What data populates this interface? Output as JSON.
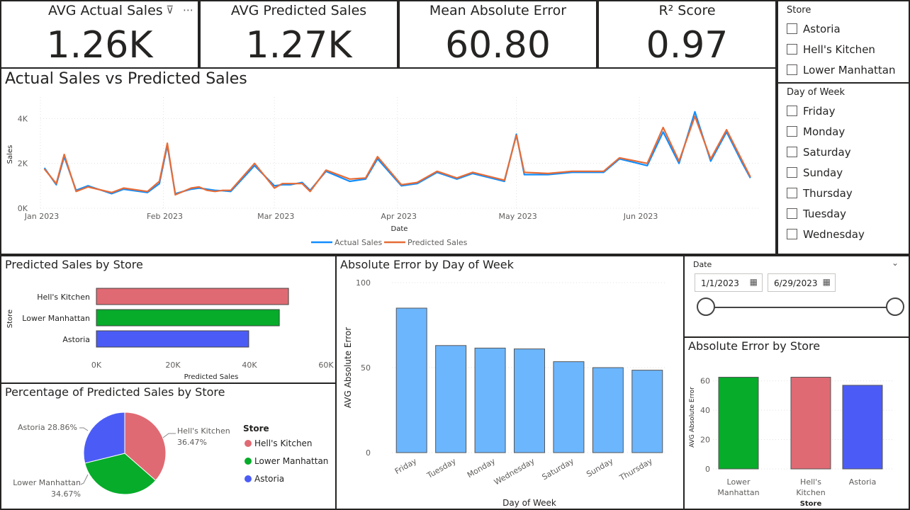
{
  "kpis": [
    {
      "title": "AVG Actual Sales",
      "value": "1.26K"
    },
    {
      "title": "AVG Predicted Sales",
      "value": "1.27K"
    },
    {
      "title": "Mean Absolute Error",
      "value": "60.80"
    },
    {
      "title": "R² Score",
      "value": "0.97"
    }
  ],
  "card_icons": {
    "filter": "filter-icon",
    "more": "more-options-icon"
  },
  "slicer_store": {
    "title": "Store",
    "items": [
      "Astoria",
      "Hell's Kitchen",
      "Lower Manhattan"
    ]
  },
  "slicer_day": {
    "title": "Day of Week",
    "items": [
      "Friday",
      "Monday",
      "Saturday",
      "Sunday",
      "Thursday",
      "Tuesday",
      "Wednesday"
    ]
  },
  "date_slicer": {
    "title": "Date",
    "start": "1/1/2023",
    "end": "6/29/2023",
    "range_fraction": [
      0,
      1
    ]
  },
  "colors": {
    "actual": "#118DFF",
    "predicted": "#E66C37",
    "hells_kitchen": "#E06A73",
    "lower_manhattan": "#06AC2A",
    "astoria": "#4B5CF6",
    "dow_bar": "#6CB6FE"
  },
  "chart_data": [
    {
      "type": "line",
      "title": "Actual Sales vs Predicted Sales",
      "xlabel": "Date",
      "ylabel": "Sales",
      "x_ticks": [
        "Jan 2023",
        "Feb 2023",
        "Mar 2023",
        "Apr 2023",
        "May 2023",
        "Jun 2023"
      ],
      "y_ticks": [
        "0K",
        "2K",
        "4K"
      ],
      "ylim": [
        0,
        4800
      ],
      "xlim": [
        "2023-01-01",
        "2023-07-01"
      ],
      "legend": "bottom",
      "series": [
        {
          "name": "Actual Sales",
          "x": [
            "2023-01-02",
            "2023-01-05",
            "2023-01-07",
            "2023-01-10",
            "2023-01-13",
            "2023-01-19",
            "2023-01-22",
            "2023-01-28",
            "2023-01-31",
            "2023-02-02",
            "2023-02-04",
            "2023-02-08",
            "2023-02-10",
            "2023-02-12",
            "2023-02-14",
            "2023-02-16",
            "2023-02-18",
            "2023-02-24",
            "2023-03-01",
            "2023-03-03",
            "2023-03-05",
            "2023-03-08",
            "2023-03-10",
            "2023-03-14",
            "2023-03-20",
            "2023-03-24",
            "2023-03-27",
            "2023-04-02",
            "2023-04-06",
            "2023-04-11",
            "2023-04-16",
            "2023-04-20",
            "2023-04-28",
            "2023-05-01",
            "2023-05-03",
            "2023-05-09",
            "2023-05-15",
            "2023-05-23",
            "2023-05-27",
            "2023-06-03",
            "2023-06-07",
            "2023-06-11",
            "2023-06-15",
            "2023-06-19",
            "2023-06-23",
            "2023-06-27",
            "2023-06-29"
          ],
          "y": [
            1800,
            1050,
            2300,
            800,
            1000,
            650,
            850,
            700,
            1100,
            2800,
            650,
            850,
            900,
            850,
            800,
            780,
            750,
            1900,
            1000,
            1050,
            1050,
            1150,
            800,
            1650,
            1200,
            1300,
            2200,
            1000,
            1100,
            1600,
            1300,
            1550,
            1200,
            3300,
            1500,
            1500,
            1600,
            1600,
            2200,
            1900,
            3400,
            2000,
            4300,
            2100,
            3400,
            2000,
            1350
          ]
        },
        {
          "name": "Predicted Sales",
          "x": [
            "2023-01-02",
            "2023-01-05",
            "2023-01-07",
            "2023-01-10",
            "2023-01-13",
            "2023-01-19",
            "2023-01-22",
            "2023-01-28",
            "2023-01-31",
            "2023-02-02",
            "2023-02-04",
            "2023-02-08",
            "2023-02-10",
            "2023-02-12",
            "2023-02-14",
            "2023-02-16",
            "2023-02-18",
            "2023-02-24",
            "2023-03-01",
            "2023-03-03",
            "2023-03-05",
            "2023-03-08",
            "2023-03-10",
            "2023-03-14",
            "2023-03-20",
            "2023-03-24",
            "2023-03-27",
            "2023-04-02",
            "2023-04-06",
            "2023-04-11",
            "2023-04-16",
            "2023-04-20",
            "2023-04-28",
            "2023-05-01",
            "2023-05-03",
            "2023-05-09",
            "2023-05-15",
            "2023-05-23",
            "2023-05-27",
            "2023-06-03",
            "2023-06-07",
            "2023-06-11",
            "2023-06-15",
            "2023-06-19",
            "2023-06-23",
            "2023-06-27",
            "2023-06-29"
          ],
          "y": [
            1750,
            1100,
            2400,
            750,
            950,
            700,
            900,
            750,
            1200,
            2900,
            600,
            900,
            950,
            800,
            750,
            800,
            800,
            2000,
            900,
            1100,
            1100,
            1100,
            750,
            1700,
            1300,
            1350,
            2300,
            1050,
            1150,
            1650,
            1350,
            1600,
            1250,
            3250,
            1600,
            1550,
            1650,
            1650,
            2250,
            2000,
            3600,
            2100,
            4100,
            2200,
            3500,
            2100,
            1400
          ]
        }
      ]
    },
    {
      "type": "bar",
      "title": "Predicted Sales by Store",
      "orientation": "horizontal",
      "categories": [
        "Hell's Kitchen",
        "Lower Manhattan",
        "Astoria"
      ],
      "values": [
        50200,
        47800,
        39800
      ],
      "xlabel": "Predicted Sales",
      "ylabel": "Store",
      "x_ticks": [
        "0K",
        "20K",
        "40K",
        "60K"
      ],
      "xlim": [
        0,
        60000
      ]
    },
    {
      "type": "pie",
      "title": "Percentage of Predicted Sales by Store",
      "legend_title": "Store",
      "legend": "right",
      "categories": [
        "Hell's Kitchen",
        "Lower Manhattan",
        "Astoria"
      ],
      "values": [
        36.47,
        34.67,
        28.86
      ],
      "labels": [
        [
          "Hell's Kitchen",
          "36.47%"
        ],
        [
          "Lower Manhattan",
          "34.67%"
        ],
        [
          "Astoria 28.86%"
        ]
      ]
    },
    {
      "type": "bar",
      "title": "Absolute Error by Day of Week",
      "categories": [
        "Friday",
        "Tuesday",
        "Monday",
        "Wednesday",
        "Saturday",
        "Sunday",
        "Thursday"
      ],
      "values": [
        85,
        63,
        61.5,
        61,
        53.5,
        50,
        48.5
      ],
      "xlabel": "Day of Week",
      "ylabel": "AVG Absolute Error",
      "y_ticks": [
        "0",
        "50",
        "100"
      ],
      "ylim": [
        0,
        100
      ]
    },
    {
      "type": "bar",
      "title": "Absolute Error by Store",
      "categories": [
        [
          "Lower",
          "Manhattan"
        ],
        [
          "Hell's",
          "Kitchen"
        ],
        [
          "Astoria"
        ]
      ],
      "values": [
        62.5,
        62.5,
        57
      ],
      "xlabel": "Store",
      "ylabel": "AVG Absolute Error",
      "y_ticks": [
        "0",
        "20",
        "40",
        "60"
      ],
      "ylim": [
        0,
        70
      ]
    }
  ]
}
